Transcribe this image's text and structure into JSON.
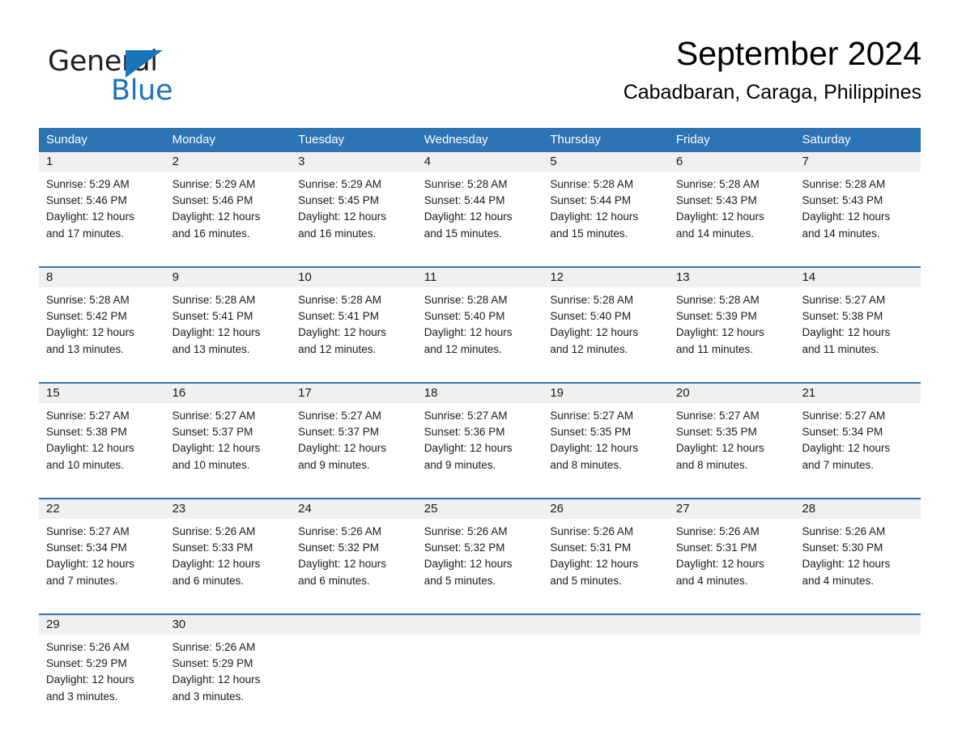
{
  "brand": {
    "name_dark": "General",
    "name_light": "Blue",
    "logo_icon": "triangle-icon",
    "accent_color": "#1a74bb"
  },
  "header": {
    "title": "September 2024",
    "subtitle": "Cabadbaran, Caraga, Philippines"
  },
  "calendar": {
    "header_color": "#2d74b5",
    "daynum_band_color": "#f0f0f0",
    "weekdays": [
      "Sunday",
      "Monday",
      "Tuesday",
      "Wednesday",
      "Thursday",
      "Friday",
      "Saturday"
    ],
    "weeks": [
      [
        {
          "day": "1",
          "lines": [
            "Sunrise: 5:29 AM",
            "Sunset: 5:46 PM",
            "Daylight: 12 hours",
            "and 17 minutes."
          ]
        },
        {
          "day": "2",
          "lines": [
            "Sunrise: 5:29 AM",
            "Sunset: 5:46 PM",
            "Daylight: 12 hours",
            "and 16 minutes."
          ]
        },
        {
          "day": "3",
          "lines": [
            "Sunrise: 5:29 AM",
            "Sunset: 5:45 PM",
            "Daylight: 12 hours",
            "and 16 minutes."
          ]
        },
        {
          "day": "4",
          "lines": [
            "Sunrise: 5:28 AM",
            "Sunset: 5:44 PM",
            "Daylight: 12 hours",
            "and 15 minutes."
          ]
        },
        {
          "day": "5",
          "lines": [
            "Sunrise: 5:28 AM",
            "Sunset: 5:44 PM",
            "Daylight: 12 hours",
            "and 15 minutes."
          ]
        },
        {
          "day": "6",
          "lines": [
            "Sunrise: 5:28 AM",
            "Sunset: 5:43 PM",
            "Daylight: 12 hours",
            "and 14 minutes."
          ]
        },
        {
          "day": "7",
          "lines": [
            "Sunrise: 5:28 AM",
            "Sunset: 5:43 PM",
            "Daylight: 12 hours",
            "and 14 minutes."
          ]
        }
      ],
      [
        {
          "day": "8",
          "lines": [
            "Sunrise: 5:28 AM",
            "Sunset: 5:42 PM",
            "Daylight: 12 hours",
            "and 13 minutes."
          ]
        },
        {
          "day": "9",
          "lines": [
            "Sunrise: 5:28 AM",
            "Sunset: 5:41 PM",
            "Daylight: 12 hours",
            "and 13 minutes."
          ]
        },
        {
          "day": "10",
          "lines": [
            "Sunrise: 5:28 AM",
            "Sunset: 5:41 PM",
            "Daylight: 12 hours",
            "and 12 minutes."
          ]
        },
        {
          "day": "11",
          "lines": [
            "Sunrise: 5:28 AM",
            "Sunset: 5:40 PM",
            "Daylight: 12 hours",
            "and 12 minutes."
          ]
        },
        {
          "day": "12",
          "lines": [
            "Sunrise: 5:28 AM",
            "Sunset: 5:40 PM",
            "Daylight: 12 hours",
            "and 12 minutes."
          ]
        },
        {
          "day": "13",
          "lines": [
            "Sunrise: 5:28 AM",
            "Sunset: 5:39 PM",
            "Daylight: 12 hours",
            "and 11 minutes."
          ]
        },
        {
          "day": "14",
          "lines": [
            "Sunrise: 5:27 AM",
            "Sunset: 5:38 PM",
            "Daylight: 12 hours",
            "and 11 minutes."
          ]
        }
      ],
      [
        {
          "day": "15",
          "lines": [
            "Sunrise: 5:27 AM",
            "Sunset: 5:38 PM",
            "Daylight: 12 hours",
            "and 10 minutes."
          ]
        },
        {
          "day": "16",
          "lines": [
            "Sunrise: 5:27 AM",
            "Sunset: 5:37 PM",
            "Daylight: 12 hours",
            "and 10 minutes."
          ]
        },
        {
          "day": "17",
          "lines": [
            "Sunrise: 5:27 AM",
            "Sunset: 5:37 PM",
            "Daylight: 12 hours",
            "and 9 minutes."
          ]
        },
        {
          "day": "18",
          "lines": [
            "Sunrise: 5:27 AM",
            "Sunset: 5:36 PM",
            "Daylight: 12 hours",
            "and 9 minutes."
          ]
        },
        {
          "day": "19",
          "lines": [
            "Sunrise: 5:27 AM",
            "Sunset: 5:35 PM",
            "Daylight: 12 hours",
            "and 8 minutes."
          ]
        },
        {
          "day": "20",
          "lines": [
            "Sunrise: 5:27 AM",
            "Sunset: 5:35 PM",
            "Daylight: 12 hours",
            "and 8 minutes."
          ]
        },
        {
          "day": "21",
          "lines": [
            "Sunrise: 5:27 AM",
            "Sunset: 5:34 PM",
            "Daylight: 12 hours",
            "and 7 minutes."
          ]
        }
      ],
      [
        {
          "day": "22",
          "lines": [
            "Sunrise: 5:27 AM",
            "Sunset: 5:34 PM",
            "Daylight: 12 hours",
            "and 7 minutes."
          ]
        },
        {
          "day": "23",
          "lines": [
            "Sunrise: 5:26 AM",
            "Sunset: 5:33 PM",
            "Daylight: 12 hours",
            "and 6 minutes."
          ]
        },
        {
          "day": "24",
          "lines": [
            "Sunrise: 5:26 AM",
            "Sunset: 5:32 PM",
            "Daylight: 12 hours",
            "and 6 minutes."
          ]
        },
        {
          "day": "25",
          "lines": [
            "Sunrise: 5:26 AM",
            "Sunset: 5:32 PM",
            "Daylight: 12 hours",
            "and 5 minutes."
          ]
        },
        {
          "day": "26",
          "lines": [
            "Sunrise: 5:26 AM",
            "Sunset: 5:31 PM",
            "Daylight: 12 hours",
            "and 5 minutes."
          ]
        },
        {
          "day": "27",
          "lines": [
            "Sunrise: 5:26 AM",
            "Sunset: 5:31 PM",
            "Daylight: 12 hours",
            "and 4 minutes."
          ]
        },
        {
          "day": "28",
          "lines": [
            "Sunrise: 5:26 AM",
            "Sunset: 5:30 PM",
            "Daylight: 12 hours",
            "and 4 minutes."
          ]
        }
      ],
      [
        {
          "day": "29",
          "lines": [
            "Sunrise: 5:26 AM",
            "Sunset: 5:29 PM",
            "Daylight: 12 hours",
            "and 3 minutes."
          ]
        },
        {
          "day": "30",
          "lines": [
            "Sunrise: 5:26 AM",
            "Sunset: 5:29 PM",
            "Daylight: 12 hours",
            "and 3 minutes."
          ]
        },
        {
          "day": "",
          "lines": []
        },
        {
          "day": "",
          "lines": []
        },
        {
          "day": "",
          "lines": []
        },
        {
          "day": "",
          "lines": []
        },
        {
          "day": "",
          "lines": []
        }
      ]
    ]
  }
}
